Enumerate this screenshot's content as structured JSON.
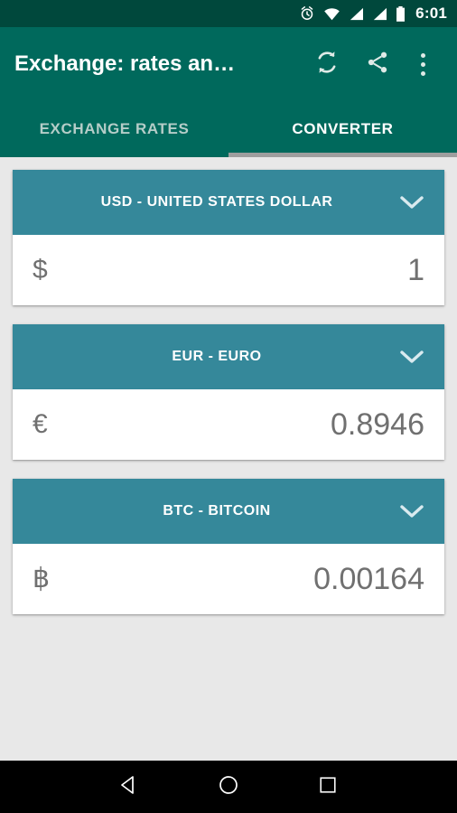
{
  "status_bar": {
    "time": "6:01",
    "icons": [
      "alarm-clock-icon",
      "wifi-icon",
      "signal-icon-1",
      "signal-icon-2",
      "battery-icon"
    ],
    "background_color": "#00483c"
  },
  "app_bar": {
    "title": "Exchange: rates an…",
    "background_color": "#00695c",
    "actions": [
      {
        "name": "refresh-icon",
        "label": "Refresh"
      },
      {
        "name": "share-icon",
        "label": "Share"
      },
      {
        "name": "overflow-menu-icon",
        "label": "More options"
      }
    ]
  },
  "tabs": {
    "items": [
      {
        "label": "EXCHANGE RATES",
        "active": false
      },
      {
        "label": "CONVERTER",
        "active": true
      }
    ],
    "indicator_color": "#9e9e9e"
  },
  "converter": {
    "card_header_color": "#35889a",
    "cards": [
      {
        "code": "USD",
        "header_label": "USD - UNITED STATES DOLLAR",
        "symbol": "$",
        "value": "1"
      },
      {
        "code": "EUR",
        "header_label": "EUR - EURO",
        "symbol": "€",
        "value": "0.8946"
      },
      {
        "code": "BTC",
        "header_label": "BTC - BITCOIN",
        "symbol": "฿",
        "value": "0.00164"
      }
    ]
  },
  "nav_bar": {
    "buttons": [
      {
        "name": "back-button",
        "label": "Back"
      },
      {
        "name": "home-button",
        "label": "Home"
      },
      {
        "name": "recents-button",
        "label": "Recents"
      }
    ]
  }
}
